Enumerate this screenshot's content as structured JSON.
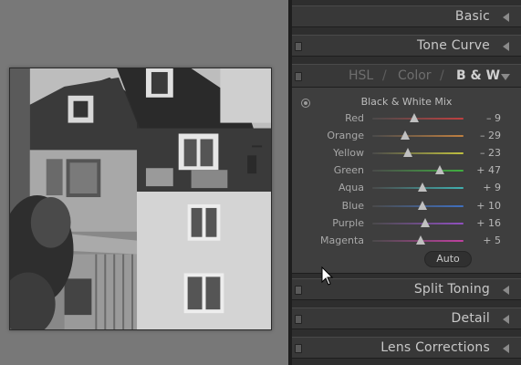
{
  "panel": {
    "sections_top": [
      {
        "title": "Basic"
      },
      {
        "title": "Tone Curve"
      }
    ],
    "hsl_tabs": {
      "hsl": "HSL",
      "sep1": "/",
      "color": "Color",
      "sep2": "/",
      "bw": "B & W",
      "active": "B & W"
    },
    "bw_mix": {
      "title": "Black & White Mix",
      "sliders": [
        {
          "label": "Red",
          "value": "– 9",
          "level": -9,
          "color": "#c04040"
        },
        {
          "label": "Orange",
          "value": "– 29",
          "level": -29,
          "color": "#c08040"
        },
        {
          "label": "Yellow",
          "value": "– 23",
          "level": -23,
          "color": "#c0c040"
        },
        {
          "label": "Green",
          "value": "+ 47",
          "level": 47,
          "color": "#40b040"
        },
        {
          "label": "Aqua",
          "value": "+ 9",
          "level": 9,
          "color": "#40b0b0"
        },
        {
          "label": "Blue",
          "value": "+ 10",
          "level": 10,
          "color": "#4070c0"
        },
        {
          "label": "Purple",
          "value": "+ 16",
          "level": 16,
          "color": "#9050c0"
        },
        {
          "label": "Magenta",
          "value": "+ 5",
          "level": 5,
          "color": "#c040a0"
        }
      ],
      "auto_label": "Auto"
    },
    "sections_bottom": [
      {
        "title": "Split Toning"
      },
      {
        "title": "Detail"
      },
      {
        "title": "Lens Corrections"
      }
    ]
  }
}
